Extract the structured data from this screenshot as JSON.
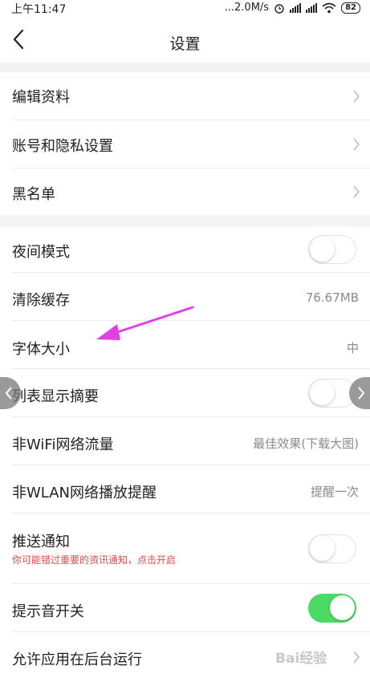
{
  "status_bar": {
    "time": "上午11:47",
    "network_speed": "...2.0M/s",
    "battery": "82"
  },
  "header": {
    "title": "设置",
    "back_icon": "chevron-left-icon"
  },
  "settings": {
    "edit_profile": {
      "label": "编辑资料"
    },
    "account_privacy": {
      "label": "账号和隐私设置"
    },
    "blacklist": {
      "label": "黑名单"
    },
    "night_mode": {
      "label": "夜间模式",
      "enabled": false
    },
    "clear_cache": {
      "label": "清除缓存",
      "value": "76.67MB"
    },
    "font_size": {
      "label": "字体大小",
      "value": "中"
    },
    "list_summary": {
      "label": "列表显示摘要",
      "enabled": false
    },
    "non_wifi_traffic": {
      "label": "非WiFi网络流量",
      "value": "最佳效果(下载大图)"
    },
    "non_wlan_play_reminder": {
      "label": "非WLAN网络播放提醒",
      "value": "提醒一次"
    },
    "push_notification": {
      "label": "推送通知",
      "sublabel": "你可能错过重要的资讯通知，点击开启",
      "enabled": false
    },
    "sound_switch": {
      "label": "提示音开关",
      "enabled": true
    },
    "background_run": {
      "label": "允许应用在后台运行"
    }
  },
  "annotation": {
    "arrow_color": "#e040e8"
  },
  "watermark": "Bai经验",
  "colors": {
    "toggle_on": "#4cd964",
    "section_gap": "#f3f3f3",
    "warning_text": "#e6484d",
    "value_text": "#8a8a8a"
  }
}
